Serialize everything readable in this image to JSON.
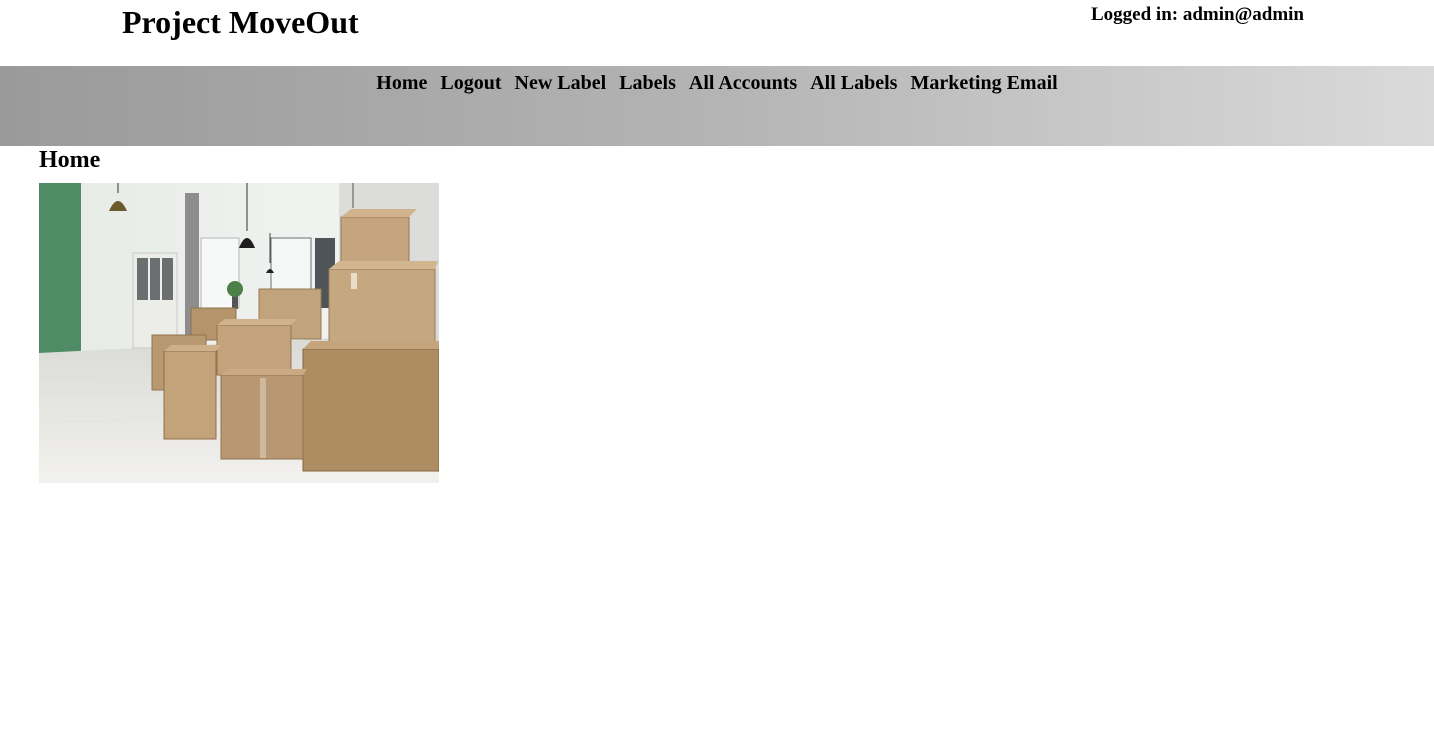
{
  "header": {
    "title": "Project MoveOut",
    "login_status": "Logged in: admin@admin"
  },
  "nav": {
    "items": [
      {
        "label": "Home"
      },
      {
        "label": "Logout"
      },
      {
        "label": "New Label"
      },
      {
        "label": "Labels"
      },
      {
        "label": "All Accounts"
      },
      {
        "label": "All Labels"
      },
      {
        "label": "Marketing Email"
      }
    ]
  },
  "main": {
    "heading": "Home",
    "image": {
      "subject": "moving-boxes-photo"
    }
  },
  "colors": {
    "nav_gradient_start": "#9a9a9a",
    "nav_gradient_end": "#dadada",
    "text": "#000000",
    "background": "#ffffff"
  }
}
